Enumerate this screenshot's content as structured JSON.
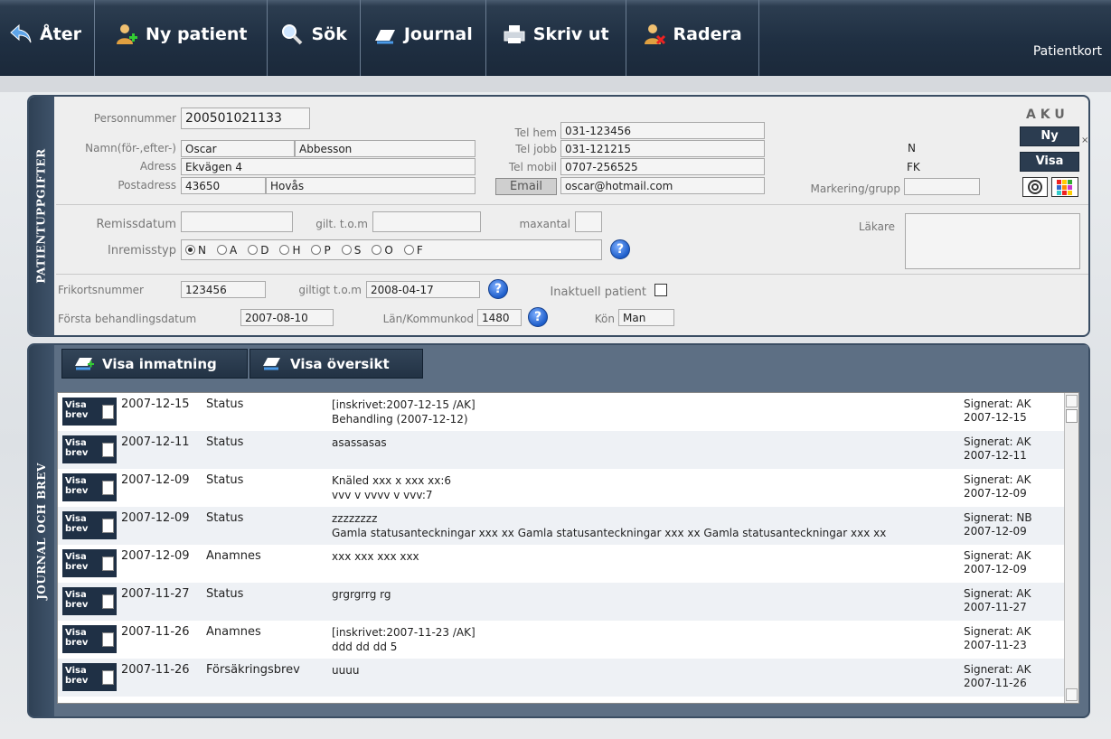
{
  "toolbar": {
    "back": "Åter",
    "new_patient": "Ny patient",
    "search": "Sök",
    "journal": "Journal",
    "print": "Skriv ut",
    "delete": "Radera",
    "title": "Patientkort"
  },
  "patient": {
    "tab_label": "PATIENTUPPGIFTER",
    "personnummer_label": "Personnummer",
    "personnummer": "200501021133",
    "namn_label": "Namn(för-,efter-)",
    "fornamn": "Oscar",
    "efternamn": "Abbesson",
    "adress_label": "Adress",
    "adress": "Ekvägen 4",
    "postadress_label": "Postadress",
    "postnr": "43650",
    "ort": "Hovås",
    "telhem_label": "Tel hem",
    "telhem": "031-123456",
    "teljobb_label": "Tel jobb",
    "teljobb": "031-121215",
    "telmobil_label": "Tel mobil",
    "telmobil": "0707-256525",
    "email_btn": "Email",
    "email": "oscar@hotmail.com",
    "n_flag": "N",
    "fk_flag": "FK",
    "markering_label": "Markering/grupp",
    "aku": "A K U",
    "ny_btn": "Ny",
    "visa_btn": "Visa",
    "x_mark": "×",
    "remissdatum_label": "Remissdatum",
    "gilt_label": "gilt. t.o.m",
    "maxantal_label": "maxantal",
    "lakare_label": "Läkare",
    "inremisstyp_label": "Inremisstyp",
    "remiss_options": [
      "N",
      "A",
      "D",
      "H",
      "P",
      "S",
      "O",
      "F"
    ],
    "remiss_selected": "N",
    "frikort_label": "Frikortsnummer",
    "frikort": "123456",
    "giltigt_label": "giltigt t.o.m",
    "giltigt": "2008-04-17",
    "inaktuell_label": "Inaktuell patient",
    "forsta_label": "Första behandlingsdatum",
    "forsta": "2007-08-10",
    "lan_label": "Län/Kommunkod",
    "lan": "1480",
    "kon_label": "Kön",
    "kon": "Man",
    "help_glyph": "?"
  },
  "journal": {
    "tab_label": "JOURNAL OCH BREV",
    "visa_inmatning": "Visa inmatning",
    "visa_oversikt": "Visa översikt",
    "visa_brev_line1": "Visa",
    "visa_brev_line2": "brev",
    "rows": [
      {
        "date": "2007-12-15",
        "type": "Status",
        "line1": " [inskrivet:2007-12-15 /AK]",
        "line2": "Behandling (2007-12-12)",
        "sig1": "Signerat: AK",
        "sig2": "2007-12-15"
      },
      {
        "date": "2007-12-11",
        "type": "Status",
        "line1": "asassasas",
        "line2": "",
        "sig1": "Signerat: AK",
        "sig2": "2007-12-11"
      },
      {
        "date": "2007-12-09",
        "type": "Status",
        "line1": "Knäled xxx x xxx xx:6",
        "line2": "vvv v vvvv v  vvv:7",
        "sig1": "Signerat: AK",
        "sig2": "2007-12-09"
      },
      {
        "date": "2007-12-09",
        "type": "Status",
        "line1": "zzzzzzzz",
        "line2": "Gamla statusanteckningar xxx xx Gamla statusanteckningar xxx xx Gamla statusanteckningar xxx xx",
        "sig1": "Signerat: NB",
        "sig2": "2007-12-09"
      },
      {
        "date": "2007-12-09",
        "type": "Anamnes",
        "line1": "xxx xxx  xxx xxx",
        "line2": "",
        "sig1": "Signerat: AK",
        "sig2": "2007-12-09"
      },
      {
        "date": "2007-11-27",
        "type": "Status",
        "line1": "grgrgrrg rg",
        "line2": "",
        "sig1": "Signerat: AK",
        "sig2": "2007-11-27"
      },
      {
        "date": "2007-11-26",
        "type": "Anamnes",
        "line1": " [inskrivet:2007-11-23 /AK]",
        "line2": "ddd dd dd   5",
        "sig1": "Signerat: AK",
        "sig2": "2007-11-23"
      },
      {
        "date": "2007-11-26",
        "type": "Försäkringsbrev",
        "line1": "uuuu",
        "line2": "",
        "sig1": "Signerat: AK",
        "sig2": "2007-11-26"
      }
    ]
  },
  "colors": {
    "toolbar_bg": "#1f2f42",
    "panel_border": "#3a4d63",
    "help_blue": "#1d5dc9"
  }
}
